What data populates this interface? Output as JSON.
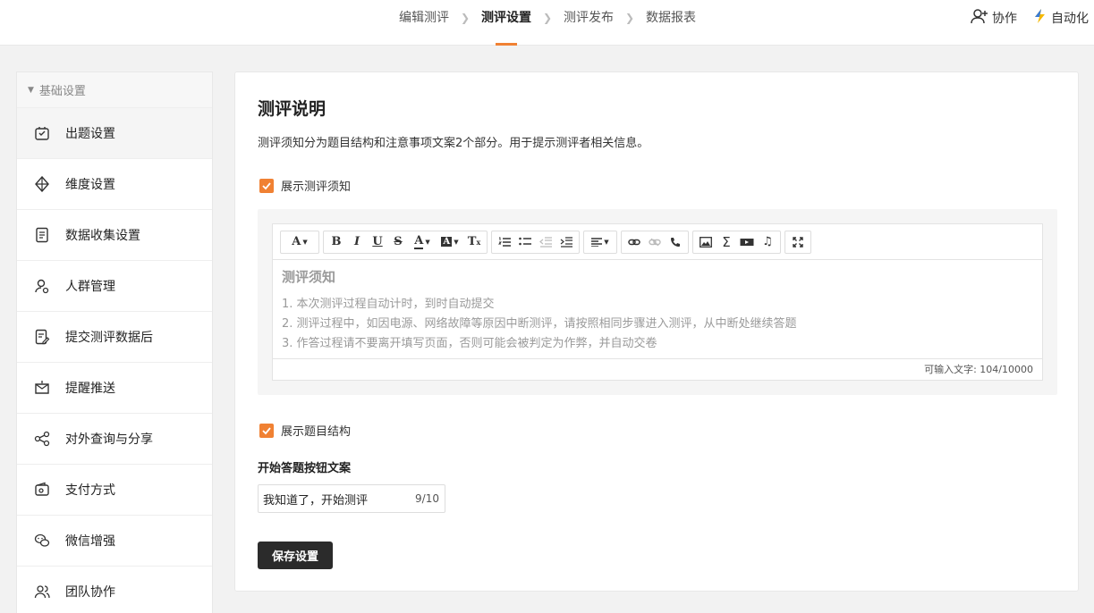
{
  "topnav": {
    "steps": [
      "编辑测评",
      "测评设置",
      "测评发布",
      "数据报表"
    ],
    "active_step": "测评设置",
    "actions": {
      "collaborate": "协作",
      "automation": "自动化"
    }
  },
  "sidebar": {
    "group_label": "基础设置",
    "items": [
      {
        "label": "出题设置",
        "icon": "question-settings-icon"
      },
      {
        "label": "维度设置",
        "icon": "dimension-icon"
      },
      {
        "label": "数据收集设置",
        "icon": "document-icon"
      },
      {
        "label": "人群管理",
        "icon": "people-icon"
      },
      {
        "label": "提交测评数据后",
        "icon": "submit-edit-icon"
      },
      {
        "label": "提醒推送",
        "icon": "mail-push-icon"
      },
      {
        "label": "对外查询与分享",
        "icon": "share-icon"
      },
      {
        "label": "支付方式",
        "icon": "wallet-icon"
      },
      {
        "label": "微信增强",
        "icon": "wechat-icon"
      },
      {
        "label": "团队协作",
        "icon": "team-icon"
      }
    ]
  },
  "main": {
    "title": "测评说明",
    "description": "测评须知分为题目结构和注意事项文案2个部分。用于提示测评者相关信息。",
    "show_notice_label": "展示测评须知",
    "editor": {
      "heading": "测评须知",
      "lines": [
        "1. 本次测评过程自动计时，到时自动提交",
        "2. 测评过程中，如因电源、网络故障等原因中断测评，请按照相同步骤进入测评，从中断处继续答题",
        "3. 作答过程请不要离开填写页面，否则可能会被判定为作弊，并自动交卷"
      ],
      "counter": "可输入文字: 104/10000"
    },
    "show_structure_label": "展示题目结构",
    "start_button_label": "开始答题按钮文案",
    "start_button_value": "我知道了，开始测评",
    "start_button_count": "9/10",
    "save_button": "保存设置"
  },
  "colors": {
    "accent": "#f08133",
    "primary_button": "#2b2b2b"
  }
}
